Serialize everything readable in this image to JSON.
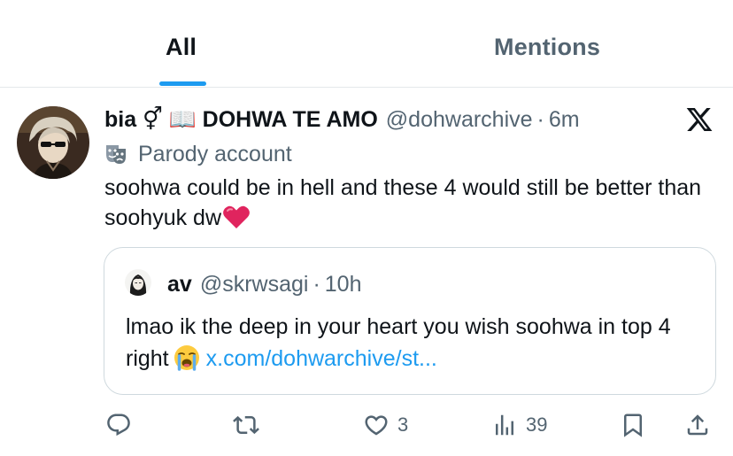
{
  "tabs": {
    "all_label": "All",
    "mentions_label": "Mentions"
  },
  "tweet": {
    "display_name": "bia ⚥ 📖 DOHWA TE AMO",
    "handle": "@dohwarchive",
    "separator": "·",
    "time": "6m",
    "account_label": "Parody account",
    "text": "soohwa could be in hell and these 4 would still be better than soohyuk dw",
    "quote": {
      "display_name": "av",
      "handle": "@skrwsagi",
      "separator": "·",
      "time": "10h",
      "text": "lmao ik the deep in your heart you wish soohwa in top 4 right",
      "link": "x.com/dohwarchive/st..."
    },
    "actions": {
      "like_count": "3",
      "views_count": "39"
    }
  },
  "colors": {
    "accent": "#1d9bf0",
    "secondary_text": "#536471",
    "primary_text": "#0f1419",
    "border": "#cfd9de",
    "heart": "#e0245e"
  },
  "icons": [
    "x-logo-icon",
    "theater-mask-icon",
    "red-heart-emoji",
    "crying-face-emoji",
    "reply-icon",
    "repost-icon",
    "like-icon",
    "views-icon",
    "bookmark-icon",
    "share-icon"
  ]
}
